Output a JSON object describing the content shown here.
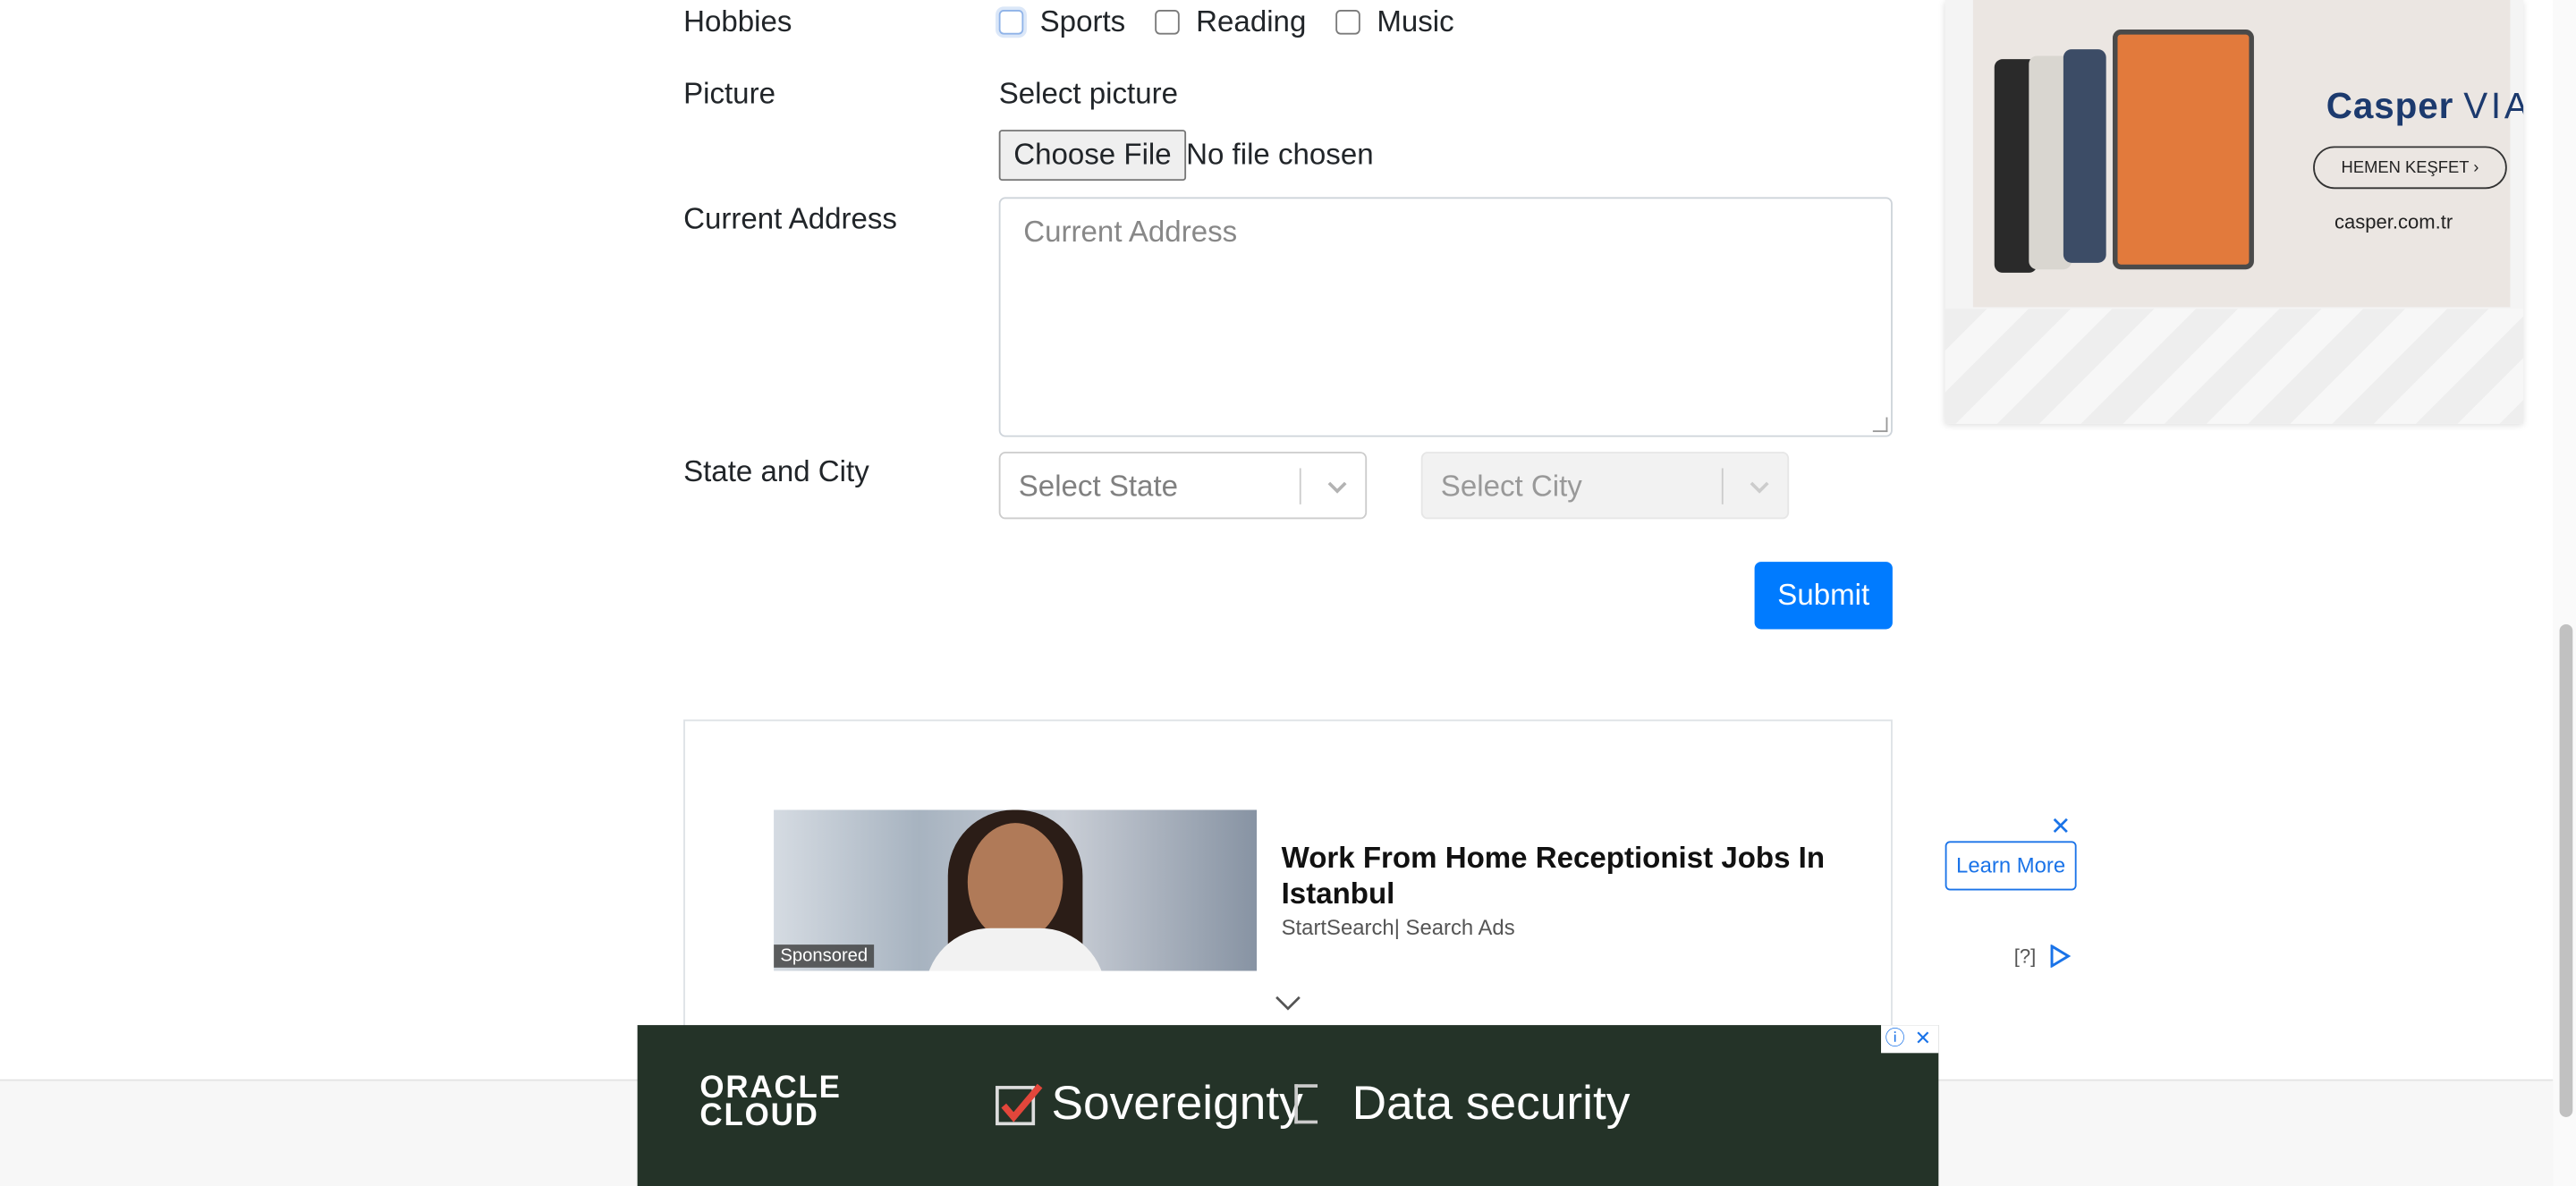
{
  "form": {
    "hobbies_label": "Hobbies",
    "hobbies": [
      "Sports",
      "Reading",
      "Music"
    ],
    "picture_label": "Picture",
    "picture_hint": "Select picture",
    "file_button": "Choose File",
    "file_status": "No file chosen",
    "address_label": "Current Address",
    "address_placeholder": "Current Address",
    "state_city_label": "State and City",
    "state_placeholder": "Select State",
    "city_placeholder": "Select City",
    "submit": "Submit"
  },
  "side_ad": {
    "brand": "Casper",
    "brand_suffix": "VIA",
    "cta": "HEMEN KEŞFET",
    "url": "casper.com.tr"
  },
  "inline_ad": {
    "sponsored": "Sponsored",
    "title": "Work From Home Receptionist Jobs In Istanbul",
    "source": "StartSearch| Search Ads",
    "cta": "Learn More",
    "close": "✕",
    "help": "[?]"
  },
  "bottom_ad": {
    "logo_line1": "ORACLE",
    "logo_line2": "CLOUD",
    "text1": "Sovereignty",
    "text2": "Data security",
    "info": "ⓘ",
    "close": "✕"
  },
  "colors": {
    "accent": "#007bff",
    "oracle_bg": "#243328"
  }
}
